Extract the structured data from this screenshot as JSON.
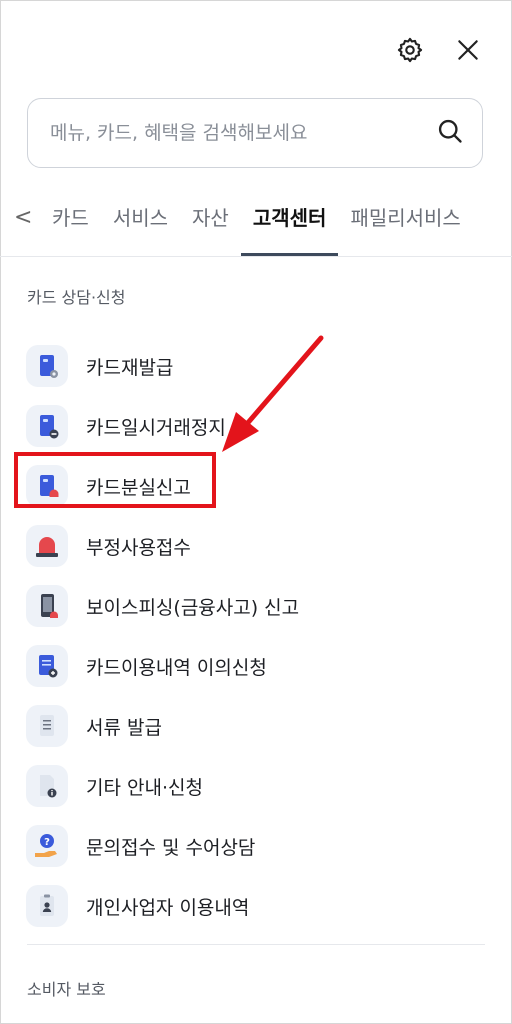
{
  "header": {
    "settings_icon": "gear-icon",
    "close_icon": "close-icon"
  },
  "search": {
    "placeholder": "메뉴, 카드, 혜택을 검색해보세요",
    "icon": "search-icon"
  },
  "tabs": {
    "prev_glyph": "<",
    "items": [
      {
        "label": "카드",
        "active": false
      },
      {
        "label": "서비스",
        "active": false
      },
      {
        "label": "자산",
        "active": false
      },
      {
        "label": "고객센터",
        "active": true
      },
      {
        "label": "패밀리서비스",
        "active": false
      }
    ]
  },
  "sections": {
    "card_counsel": "카드 상담·신청",
    "consumer_protection": "소비자 보호"
  },
  "menu": [
    {
      "label": "카드재발급",
      "icon": "card-reissue-icon"
    },
    {
      "label": "카드일시거래정지",
      "icon": "card-suspend-icon"
    },
    {
      "label": "카드분실신고",
      "icon": "card-lost-icon"
    },
    {
      "label": "부정사용접수",
      "icon": "alarm-siren-icon"
    },
    {
      "label": "보이스피싱(금융사고) 신고",
      "icon": "phone-alert-icon"
    },
    {
      "label": "카드이용내역 이의신청",
      "icon": "statement-objection-icon"
    },
    {
      "label": "서류 발급",
      "icon": "document-icon"
    },
    {
      "label": "기타 안내·신청",
      "icon": "info-document-icon"
    },
    {
      "label": "문의접수 및 수어상담",
      "icon": "question-hand-icon"
    },
    {
      "label": "개인사업자 이용내역",
      "icon": "business-id-icon"
    }
  ],
  "annotation": {
    "highlight_color": "#e3141b",
    "highlighted_item": "카드분실신고"
  },
  "colors": {
    "active_tab_underline": "#3d4a5c",
    "icon_blue": "#3b5bdb",
    "icon_red": "#e5484d"
  }
}
